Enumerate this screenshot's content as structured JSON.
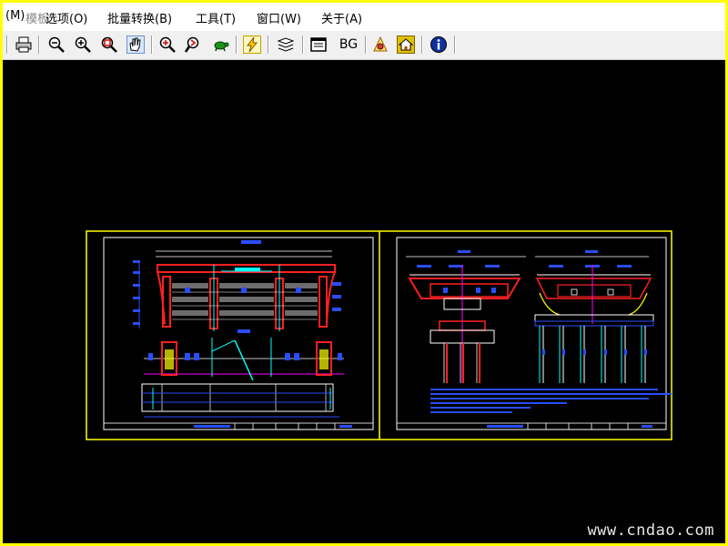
{
  "menubar": {
    "items": [
      {
        "label": "(M)"
      },
      {
        "label": "选项(O)"
      },
      {
        "label": "批量转换(B)"
      },
      {
        "label": "工具(T)"
      },
      {
        "label": "窗口(W)"
      },
      {
        "label": "关于(A)"
      }
    ],
    "overlay_text": "模板"
  },
  "toolbar": {
    "bg_label": "BG",
    "icons": [
      "print-icon",
      "zoom-out-icon",
      "zoom-in-icon",
      "zoom-window-icon",
      "pan-hand-icon",
      "zoom-realtime-icon",
      "zoom-extents-icon",
      "turtle-icon",
      "lightning-icon",
      "layers-icon",
      "window-icon",
      "bg-text-icon",
      "settings-icon",
      "home-icon",
      "info-icon"
    ]
  },
  "viewer": {
    "background": "#000000",
    "watermark": "www.cndao.com"
  },
  "colors": {
    "sheet_border": "#ffff00",
    "red": "#ff2020",
    "cyan": "#00ffff",
    "blue": "#2a4dff",
    "magenta": "#ff00ff",
    "white": "#ffffff"
  }
}
